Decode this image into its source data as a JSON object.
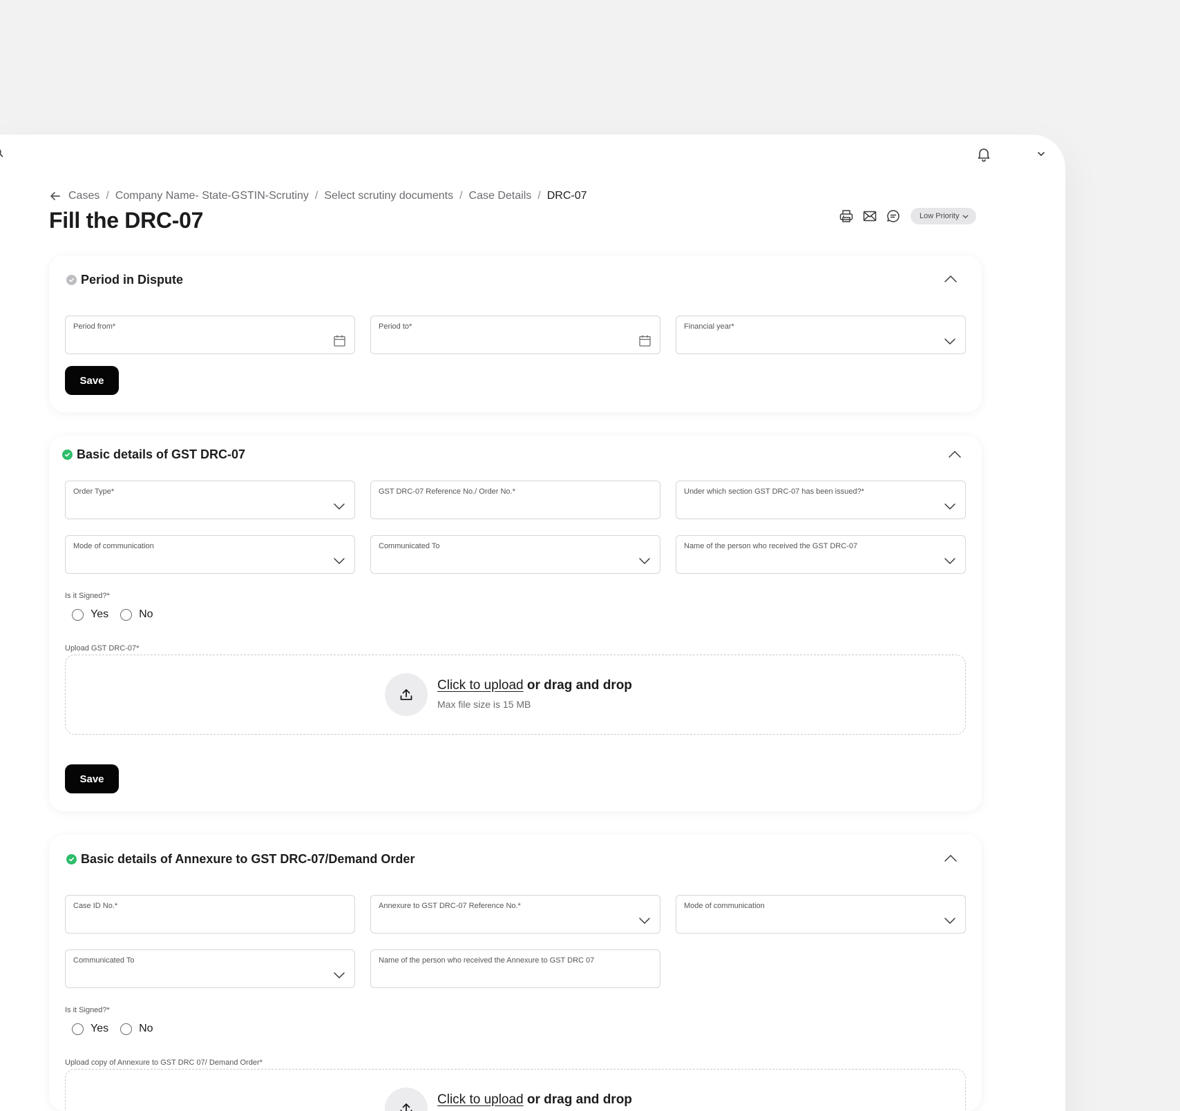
{
  "breadcrumb": {
    "items": [
      "Cases",
      "Company Name- State-GSTIN-Scrutiny",
      "Select scrutiny documents",
      "Case Details"
    ],
    "current": "DRC-07",
    "separator": "/"
  },
  "page": {
    "title": "Fill the DRC-07"
  },
  "header_actions": {
    "icons": [
      "printer-icon",
      "mail-icon",
      "chat-icon",
      "bell-icon"
    ],
    "priority_label": "Low Priority"
  },
  "section1": {
    "title": "Period in Dispute",
    "status": "grey",
    "fields": {
      "period_from": "Period from*",
      "period_to": "Period to*",
      "financial_year": "Financial year*"
    },
    "save_label": "Save"
  },
  "section2": {
    "title": "Basic details of GST DRC-07",
    "status": "green",
    "fields": {
      "order_type": "Order Type*",
      "reference_no": "GST DRC-07 Reference No./ Order No.*",
      "section_issued": "Under which section GST DRC-07 has been issued?*",
      "mode": "Mode of communication",
      "communicated_to": "Communicated To",
      "receiver_name": "Name of the person who received the GST DRC-07"
    },
    "signed_label": "Is it Signed?*",
    "radio_yes": "Yes",
    "radio_no": "No",
    "upload_label": "Upload GST DRC-07*",
    "upload_link": "Click to upload",
    "upload_rest": "or drag and drop",
    "upload_hint": "Max file size is 15 MB",
    "save_label": "Save"
  },
  "section3": {
    "title": "Basic details of Annexure to GST DRC-07/Demand Order",
    "status": "green",
    "fields": {
      "case_id": "Case ID No.*",
      "annexure_ref": "Annexure to GST DRC-07 Reference No.*",
      "mode": "Mode of communication",
      "communicated_to": "Communicated To",
      "receiver_name": "Name of the person who received the Annexure to GST DRC 07"
    },
    "signed_label": "Is it Signed?*",
    "radio_yes": "Yes",
    "radio_no": "No",
    "upload_label": "Upload copy of Annexure to GST DRC 07/ Demand Order*",
    "upload_link": "Click to upload",
    "upload_rest": "or drag and drop"
  }
}
